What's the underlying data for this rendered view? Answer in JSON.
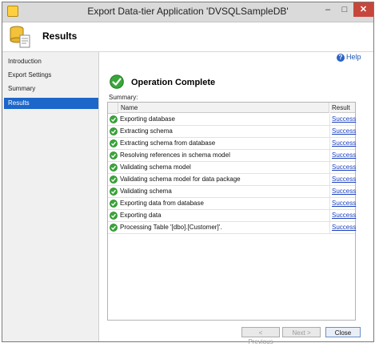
{
  "window": {
    "title": "Export Data-tier Application 'DVSQLSampleDB'",
    "controls": {
      "minimize": "–",
      "maximize": "□",
      "close": "✕"
    }
  },
  "header": {
    "title": "Results",
    "icon": "database-export-icon"
  },
  "sidebar": {
    "items": [
      {
        "label": "Introduction"
      },
      {
        "label": "Export Settings"
      },
      {
        "label": "Summary"
      },
      {
        "label": "Results",
        "active": true
      }
    ]
  },
  "help": {
    "label": "Help",
    "icon_glyph": "?"
  },
  "operation": {
    "title": "Operation Complete",
    "status_icon": "success-check-icon"
  },
  "summary": {
    "label": "Summary:",
    "columns": {
      "name": "Name",
      "result": "Result"
    },
    "rows": [
      {
        "name": "Exporting database",
        "result": "Success"
      },
      {
        "name": "Extracting schema",
        "result": "Success"
      },
      {
        "name": "Extracting schema from database",
        "result": "Success"
      },
      {
        "name": "Resolving references in schema model",
        "result": "Success"
      },
      {
        "name": "Validating schema model",
        "result": "Success"
      },
      {
        "name": "Validating schema model for data package",
        "result": "Success"
      },
      {
        "name": "Validating schema",
        "result": "Success"
      },
      {
        "name": "Exporting data from database",
        "result": "Success"
      },
      {
        "name": "Exporting data",
        "result": "Success"
      },
      {
        "name": "Processing Table '[dbo].[Customer]'.",
        "result": "Success"
      }
    ]
  },
  "buttons": {
    "previous": "< Previous",
    "next": "Next >",
    "close": "Close"
  },
  "colors": {
    "accent": "#1c67c9",
    "success": "#2f9e2f",
    "link": "#1a3fbf",
    "close_button": "#c7463c"
  }
}
